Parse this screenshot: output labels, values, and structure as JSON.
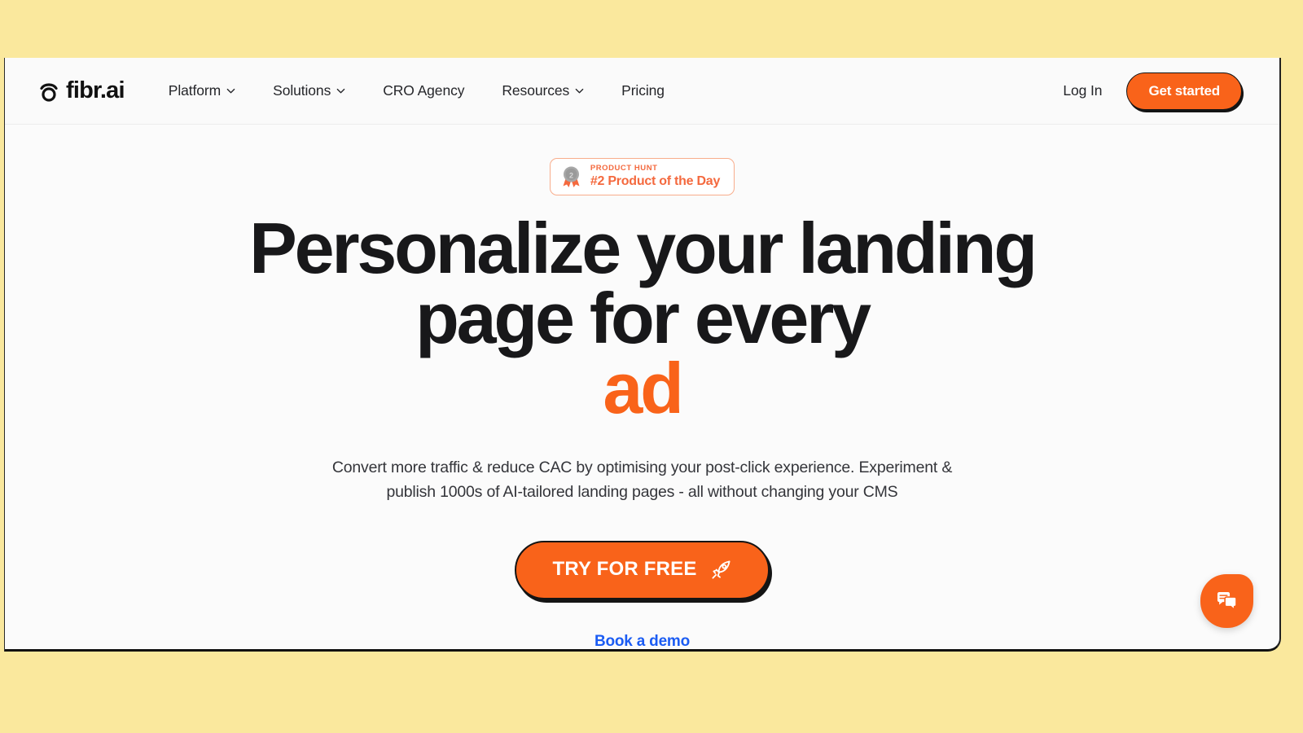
{
  "theme": {
    "page_background": "#fae89d",
    "card_background": "#fbfbfb",
    "header_background": "#fafafa",
    "accent_orange": "#f9631a",
    "badge_orange": "#f4693e",
    "link_blue": "#1b5cf3",
    "heading_color": "#18181a"
  },
  "header": {
    "brand": {
      "name": "fibr.ai",
      "logo_icon": "eye-circle-icon"
    },
    "nav": [
      {
        "label": "Platform",
        "has_dropdown": true
      },
      {
        "label": "Solutions",
        "has_dropdown": true
      },
      {
        "label": "CRO Agency",
        "has_dropdown": false
      },
      {
        "label": "Resources",
        "has_dropdown": true
      },
      {
        "label": "Pricing",
        "has_dropdown": false
      }
    ],
    "login_label": "Log In",
    "get_started_label": "Get started"
  },
  "hero": {
    "badge": {
      "icon": "medal-icon",
      "medal_rank": "2",
      "kicker": "PRODUCT HUNT",
      "title": "#2 Product of the Day"
    },
    "title_line_1": "Personalize your landing",
    "title_line_2": "page for every",
    "title_accent": "ad",
    "sub_line_1": "Convert more traffic & reduce CAC by optimising your post-click experience. Experiment &",
    "sub_line_2": "publish 1000s of AI-tailored landing pages - all without changing your CMS",
    "cta_label": "TRY FOR FREE",
    "cta_icon": "rocket-icon",
    "demo_link_label": "Book a demo"
  },
  "chat_widget": {
    "icon": "chat-bubbles-icon"
  }
}
